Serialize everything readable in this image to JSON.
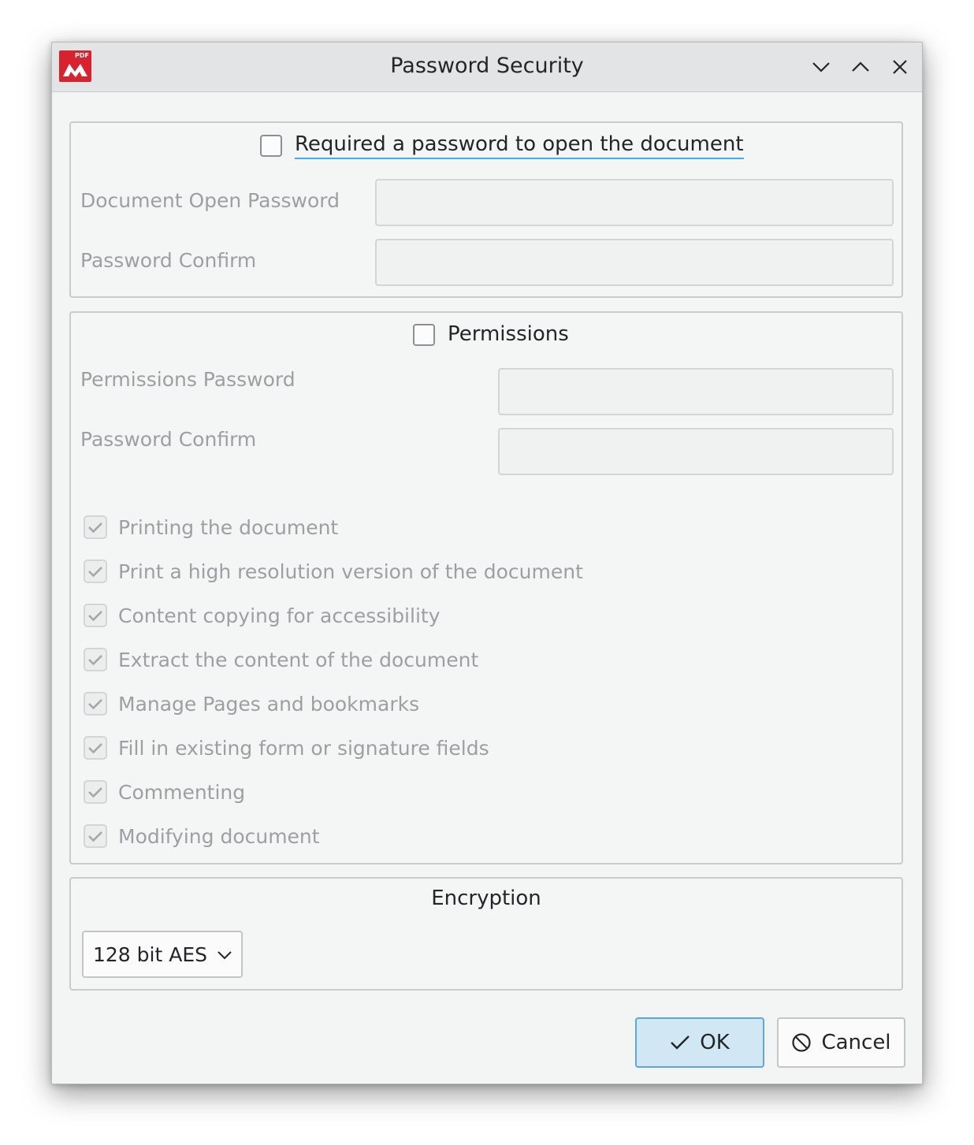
{
  "window": {
    "title": "Password Security",
    "app_icon": "pdf-editor-logo",
    "app_icon_badge": "PDF",
    "accent_color": "#3daee9",
    "brand_color": "#d8232f"
  },
  "open_password": {
    "checkbox_label": "Required a password to open the document",
    "checked": false,
    "document_open_password_label": "Document Open Password",
    "password_confirm_label": "Password Confirm",
    "document_open_password_value": "",
    "password_confirm_value": ""
  },
  "permissions": {
    "checkbox_label": "Permissions",
    "checked": false,
    "permissions_password_label": "Permissions Password",
    "password_confirm_label": "Password Confirm",
    "permissions_password_value": "",
    "password_confirm_value": "",
    "items": [
      {
        "label": "Printing the document",
        "checked": true
      },
      {
        "label": "Print a high resolution version of the document",
        "checked": true
      },
      {
        "label": "Content copying for accessibility",
        "checked": true
      },
      {
        "label": "Extract the content of the document",
        "checked": true
      },
      {
        "label": "Manage Pages and bookmarks",
        "checked": true
      },
      {
        "label": "Fill in existing form or signature fields",
        "checked": true
      },
      {
        "label": "Commenting",
        "checked": true
      },
      {
        "label": "Modifying document",
        "checked": true
      }
    ]
  },
  "encryption": {
    "title": "Encryption",
    "selected": "128 bit AES"
  },
  "buttons": {
    "ok_label": "OK",
    "cancel_label": "Cancel"
  }
}
